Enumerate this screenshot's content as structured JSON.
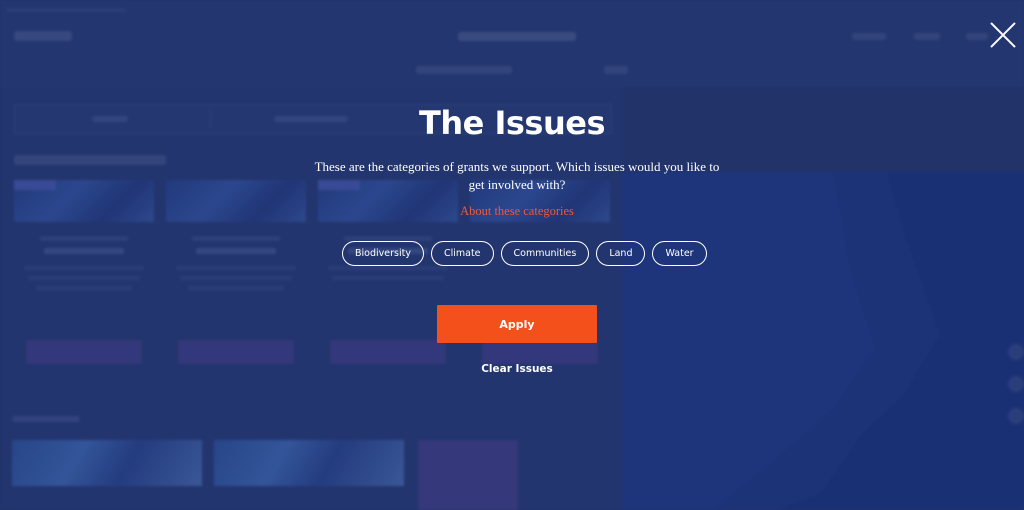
{
  "modal": {
    "title": "The Issues",
    "description": "These are the categories of grants we support. Which issues would you like to get involved with?",
    "about_link": "About these categories",
    "chips": [
      {
        "label": "Biodiversity"
      },
      {
        "label": "Climate"
      },
      {
        "label": "Communities"
      },
      {
        "label": "Land"
      },
      {
        "label": "Water"
      }
    ],
    "apply_label": "Apply",
    "clear_label": "Clear Issues",
    "close_icon": "close-icon"
  },
  "colors": {
    "accent": "#f3501c",
    "link": "#f0573b",
    "overlay": "#18265a",
    "text": "#ffffff"
  }
}
